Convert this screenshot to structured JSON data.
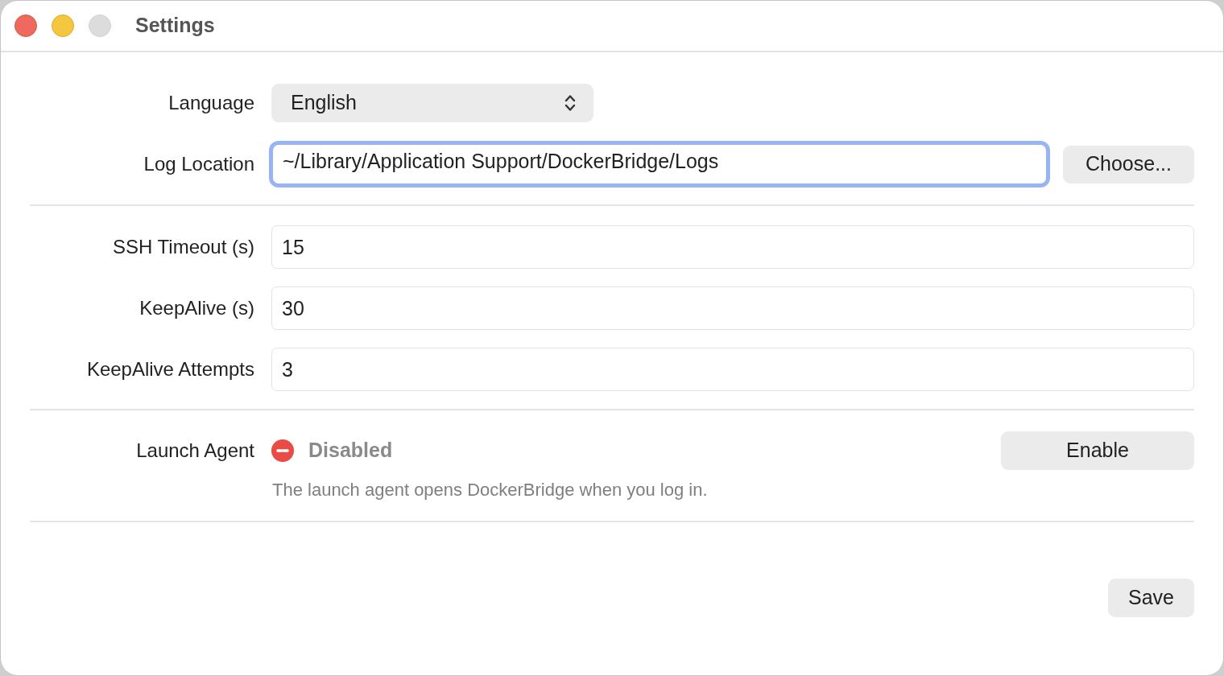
{
  "window": {
    "title": "Settings",
    "traffic_lights": [
      {
        "kind": "close",
        "disabled": false
      },
      {
        "kind": "minimize",
        "disabled": false
      },
      {
        "kind": "zoom",
        "disabled": true
      }
    ]
  },
  "sections": [
    {
      "rows": [
        {
          "kind": "popup",
          "label": "Language",
          "value": "English"
        },
        {
          "kind": "path",
          "label": "Log Location",
          "value": "~/Library/Application Support/DockerBridge/Logs",
          "focused": true,
          "button": "Choose..."
        }
      ]
    },
    {
      "rows": [
        {
          "kind": "text",
          "label": "SSH Timeout (s)",
          "value": "15",
          "focused": false
        },
        {
          "kind": "text",
          "label": "KeepAlive (s)",
          "value": "30",
          "focused": false
        },
        {
          "kind": "text",
          "label": "KeepAlive Attempts",
          "value": "3",
          "focused": false
        }
      ]
    },
    {
      "rows": [
        {
          "kind": "status",
          "label": "Launch Agent",
          "status": "Disabled",
          "enabled": false,
          "button": "Enable",
          "help": "The launch agent opens DockerBridge when you log in."
        }
      ]
    }
  ],
  "footer": {
    "button": "Save"
  }
}
